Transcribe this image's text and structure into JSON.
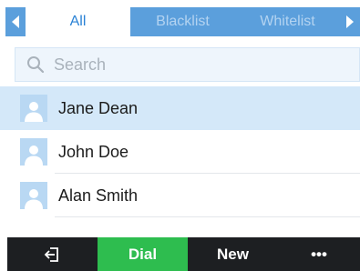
{
  "tabs": {
    "items": [
      {
        "label": "All",
        "active": true
      },
      {
        "label": "Blacklist",
        "active": false
      },
      {
        "label": "Whitelist",
        "active": false
      }
    ],
    "left_arrow_icon": "chevron-left-icon",
    "right_arrow_icon": "chevron-right-icon"
  },
  "search": {
    "placeholder": "Search",
    "value": "",
    "icon": "search-icon"
  },
  "contacts": [
    {
      "name": "Jane Dean",
      "selected": true
    },
    {
      "name": "John Doe",
      "selected": false
    },
    {
      "name": "Alan Smith",
      "selected": false
    }
  ],
  "softkeys": {
    "back_icon": "exit-icon",
    "dial_label": "Dial",
    "new_label": "New",
    "more_label": "•••"
  },
  "colors": {
    "tab_bar": "#5b9fdc",
    "active_tab_text": "#2a82d5",
    "selected_row": "#d4e8f9",
    "dial_button": "#2ebd4f",
    "softkey_bar": "#1d1f22"
  }
}
